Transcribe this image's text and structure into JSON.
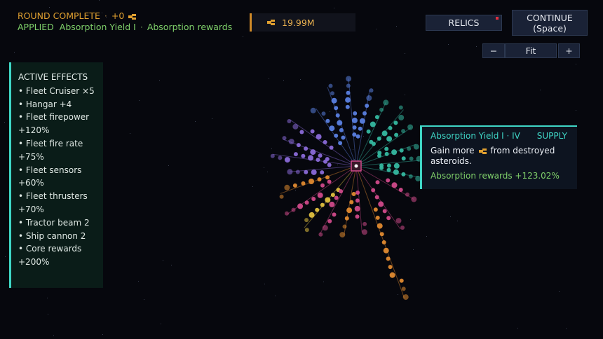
{
  "hud": {
    "round_status": "ROUND COMPLETE",
    "round_gain": "+0",
    "applied_label": "APPLIED",
    "applied_upgrade": "Absorption Yield I",
    "applied_effect": "Absorption rewards"
  },
  "resource": {
    "amount": "19.99M",
    "icon": "ore-icon"
  },
  "buttons": {
    "relics": "RELICS",
    "continue": "CONTINUE",
    "continue_hint": "(Space)",
    "zoom_out": "−",
    "zoom_fit": "Fit",
    "zoom_in": "+"
  },
  "effects_panel": {
    "title": "ACTIVE EFFECTS",
    "items": [
      "• Fleet Cruiser ×5",
      "• Hangar +4",
      "• Fleet firepower",
      "+120%",
      "• Fleet fire rate",
      "+75%",
      "• Fleet sensors",
      "+60%",
      "• Fleet thrusters",
      "+70%",
      "• Tractor beam 2",
      "• Ship cannon 2",
      "• Core rewards",
      "+200%"
    ]
  },
  "tooltip": {
    "title": "Absorption Yield I · IV",
    "category": "SUPPLY",
    "desc_pre": "Gain more",
    "desc_post": "from destroyed",
    "desc_line2": "asteroids.",
    "stat": "Absorption rewards +123.02%"
  },
  "colors": {
    "accent_teal": "#3fd6c6",
    "ore_orange": "#e0a030",
    "applied_green": "#7fd06a",
    "branch_blue": "#5a7fe0",
    "branch_purple": "#8a6ad8",
    "branch_teal": "#35b8a0",
    "branch_pink": "#d04a8a",
    "branch_orange": "#e08a30",
    "branch_yellow": "#e0c040"
  }
}
